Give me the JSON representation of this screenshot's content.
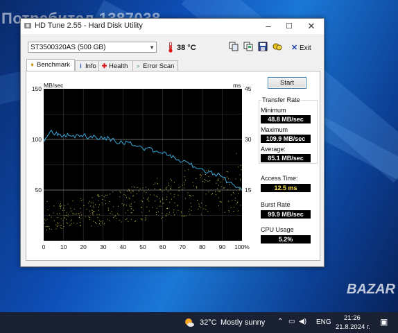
{
  "desktop": {
    "watermark": "Потребител 1387038",
    "brand_watermark": "BAZAR"
  },
  "window": {
    "title": "HD Tune 2.55 - Hard Disk Utility",
    "controls": {
      "minimize": "–",
      "maximize": "☐",
      "close": "✕"
    }
  },
  "toolbar": {
    "drive": "ST3500320AS (500 GB)",
    "temperature": "38 °C",
    "exit_label": "Exit"
  },
  "tabs": [
    {
      "label": "Benchmark",
      "icon": "benchmark-icon",
      "active": true
    },
    {
      "label": "Info",
      "icon": "info-icon",
      "active": false
    },
    {
      "label": "Health",
      "icon": "health-icon",
      "active": false
    },
    {
      "label": "Error Scan",
      "icon": "error-scan-icon",
      "active": false
    }
  ],
  "side": {
    "start_label": "Start",
    "transfer_rate_title": "Transfer Rate",
    "minimum_label": "Minimum",
    "minimum_value": "48.8 MB/sec",
    "maximum_label": "Maximum",
    "maximum_value": "109.9 MB/sec",
    "average_label": "Average:",
    "average_value": "85.1 MB/sec",
    "access_time_label": "Access Time:",
    "access_time_value": "12.5 ms",
    "burst_rate_label": "Burst Rate",
    "burst_rate_value": "99.9 MB/sec",
    "cpu_usage_label": "CPU Usage",
    "cpu_usage_value": "5.2%"
  },
  "chart_data": {
    "type": "line",
    "y_left_label": "MB/sec",
    "y_right_label": "ms",
    "y_left_ticks": [
      "150",
      "100",
      "50"
    ],
    "y_right_ticks": [
      "45",
      "30",
      "15"
    ],
    "x_ticks": [
      "0",
      "10",
      "20",
      "30",
      "40",
      "50",
      "60",
      "70",
      "80",
      "90",
      "100%"
    ],
    "ylim_left": [
      0,
      150
    ],
    "ylim_right": [
      0,
      45
    ],
    "xlim": [
      0,
      100
    ],
    "grid": true,
    "background": "#000000",
    "grid_color": "#3a3a3a",
    "series": [
      {
        "color": "#3aa7d8",
        "x": [
          0,
          2,
          4,
          6,
          8,
          10,
          12,
          15,
          18,
          20,
          23,
          26,
          30,
          33,
          36,
          40,
          43,
          46,
          50,
          53,
          56,
          60,
          63,
          66,
          70,
          73,
          76,
          80,
          83,
          86,
          90,
          93,
          96,
          100
        ],
        "y": [
          100,
          104,
          109,
          106,
          105,
          104,
          106,
          104,
          103,
          104,
          102,
          103,
          100,
          101,
          98,
          96,
          97,
          94,
          91,
          92,
          88,
          86,
          84,
          82,
          78,
          77,
          73,
          71,
          68,
          66,
          63,
          58,
          55,
          50
        ]
      }
    ],
    "scatter_color": "#c8c24a",
    "scatter_description_count": 420
  },
  "taskbar": {
    "weather_temp": "32°C",
    "weather_desc": "Mostly sunny",
    "language": "ENG",
    "time": "21:26",
    "date": "21.8.2024 г."
  }
}
